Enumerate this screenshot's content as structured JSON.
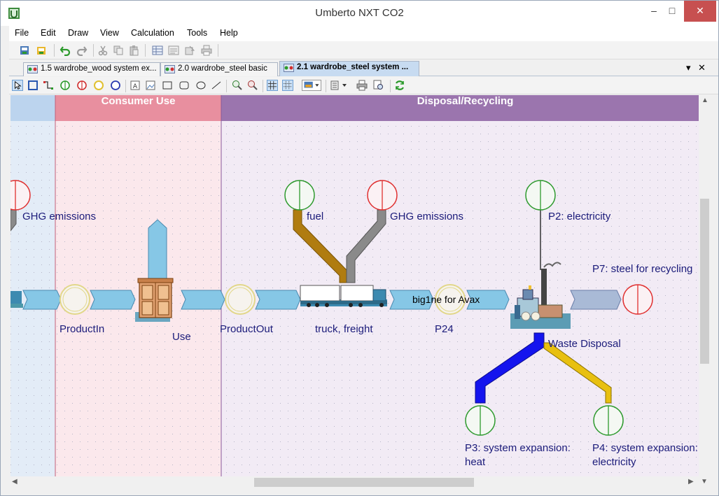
{
  "window": {
    "title": "Umberto NXT CO2",
    "minimize": "–",
    "maximize": "□",
    "close": "✕"
  },
  "menu": [
    "File",
    "Edit",
    "Draw",
    "View",
    "Calculation",
    "Tools",
    "Help"
  ],
  "tabs": [
    {
      "label": "1.5 wardrobe_wood system ex...",
      "active": false
    },
    {
      "label": "2.0 wardrobe_steel basic",
      "active": false
    },
    {
      "label": "2.1 wardrobe_steel system ...",
      "active": true
    }
  ],
  "tab_controls": {
    "dropdown": "▾",
    "close": "✕"
  },
  "lanes": [
    {
      "title": "",
      "color": "#bcd4ee"
    },
    {
      "title": "Consumer Use",
      "color": "#e88f9f"
    },
    {
      "title": "Disposal/Recycling",
      "color": "#9b75ae"
    }
  ],
  "labels": {
    "ghg_left": "GHG emissions",
    "fuel": "fuel",
    "ghg_right": "GHG emissions",
    "p2": "P2: electricity",
    "p7": "P7: steel for recycling",
    "productin": "ProductIn",
    "use": "Use",
    "productout": "ProductOut",
    "truck": "truck, freight",
    "flow_label": "big1ne for Avax",
    "p24": "P24",
    "waste": "Waste Disposal",
    "p3_line1": "P3: system expansion:",
    "p3_line2": "heat",
    "p4_line1": "P4: system expansion:",
    "p4_line2": "electricity"
  },
  "colors": {
    "input_place": "#2e9a2e",
    "output_place": "#e03030",
    "connection_place": "#e2d78a",
    "flow_arrow": "#86c7e6",
    "fuel_arrow": "#b07c10",
    "ghg_arrow": "#8a8a8a",
    "heat_arrow": "#1414ee",
    "electricity_arrow": "#e8c010",
    "recycling_arrow": "#a9bad6"
  },
  "icons": {
    "toolbar1": [
      "new-diagram-icon",
      "open-icon",
      "undo-icon",
      "redo-icon",
      "cut-icon",
      "copy-icon",
      "paste-icon",
      "table-icon",
      "list-icon",
      "export-icon",
      "print-icon"
    ],
    "toolbar2": [
      "select-icon",
      "rectangle-select-icon",
      "connect-icon",
      "input-place-icon",
      "output-place-icon",
      "connection-place-icon",
      "transition-icon",
      "text-icon",
      "image-icon",
      "rectangle-icon",
      "rounded-rectangle-icon",
      "ellipse-icon",
      "line-icon",
      "zoom-in-icon",
      "zoom-out-icon",
      "grid-icon",
      "snap-icon",
      "color-icon",
      "layout-icon",
      "print-icon",
      "print-preview-icon",
      "refresh-icon"
    ]
  }
}
